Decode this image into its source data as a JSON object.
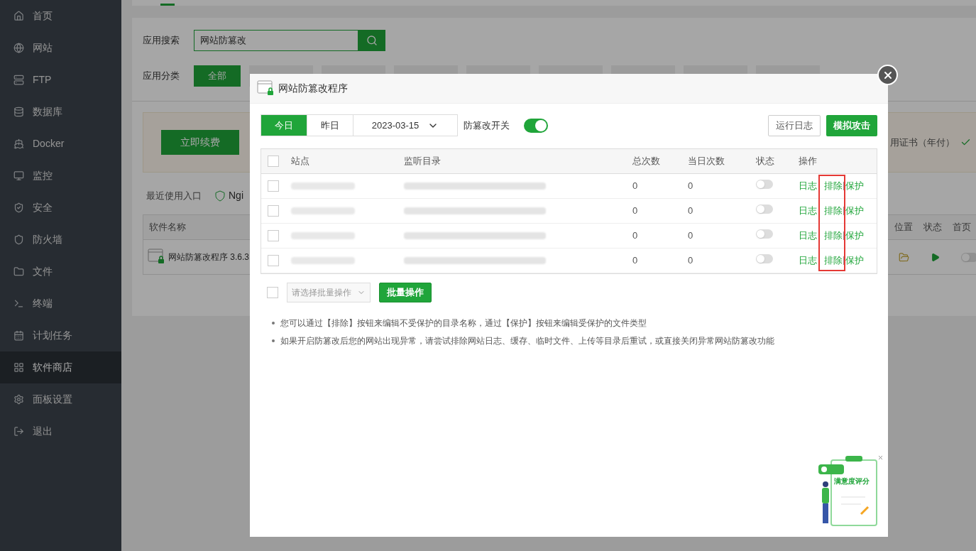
{
  "sidebar": {
    "items": [
      {
        "label": "首页",
        "selected": false
      },
      {
        "label": "网站",
        "selected": false
      },
      {
        "label": "FTP",
        "selected": false
      },
      {
        "label": "数据库",
        "selected": false
      },
      {
        "label": "Docker",
        "selected": false
      },
      {
        "label": "监控",
        "selected": false
      },
      {
        "label": "安全",
        "selected": false
      },
      {
        "label": "防火墙",
        "selected": false
      },
      {
        "label": "文件",
        "selected": false
      },
      {
        "label": "终端",
        "selected": false
      },
      {
        "label": "计划任务",
        "selected": false
      },
      {
        "label": "软件商店",
        "selected": true
      },
      {
        "label": "面板设置",
        "selected": false
      },
      {
        "label": "退出",
        "selected": false
      }
    ]
  },
  "search": {
    "label": "应用搜索",
    "value": "网站防篡改"
  },
  "category": {
    "label": "应用分类",
    "tabs": [
      {
        "label": "全部",
        "selected": true
      }
    ]
  },
  "banner": {
    "button": "立即续费",
    "text": "用证书（年付）"
  },
  "recent": {
    "label": "最近使用入口",
    "items": [
      "Ngi"
    ]
  },
  "software_table": {
    "columns": [
      "软件名称"
    ],
    "right_columns": [
      "位置",
      "状态",
      "首页"
    ],
    "row": {
      "name": "网站防篡改程序 3.6.3",
      "on": false
    }
  },
  "modal": {
    "title": "网站防篡改程序",
    "tabs": [
      {
        "label": "今日",
        "selected": true
      },
      {
        "label": "昨日",
        "selected": false
      }
    ],
    "date": "2023-03-15",
    "switch": {
      "label": "防篡改开关",
      "on": true
    },
    "buttons": [
      "运行日志",
      "模拟攻击"
    ],
    "table": {
      "all_checked": false,
      "columns": [
        "站点",
        "监听目录",
        "总次数",
        "当日次数",
        "状态",
        "操作"
      ],
      "rows": [
        {
          "checked": false,
          "total": "0",
          "today": "0",
          "on": false,
          "actions": [
            "日志",
            "排除",
            "保护"
          ]
        },
        {
          "checked": false,
          "total": "0",
          "today": "0",
          "on": false,
          "actions": [
            "日志",
            "排除",
            "保护"
          ]
        },
        {
          "checked": false,
          "total": "0",
          "today": "0",
          "on": false,
          "actions": [
            "日志",
            "排除",
            "保护"
          ]
        },
        {
          "checked": false,
          "total": "0",
          "today": "0",
          "on": false,
          "actions": [
            "日志",
            "排除",
            "保护"
          ]
        }
      ]
    },
    "batch": {
      "checked": false,
      "placeholder": "请选择批量操作",
      "button": "批量操作"
    },
    "notes": [
      "您可以通过【排除】按钮来编辑不受保护的目录名称，通过【保护】按钮来编辑受保护的文件类型",
      "如果开启防篡改后您的网站出现异常，请尝试排除网站日志、缓存、临时文件、上传等目录后重试，或直接关闭异常网站防篡改功能"
    ],
    "rating": {
      "label": "满意度评分"
    }
  }
}
